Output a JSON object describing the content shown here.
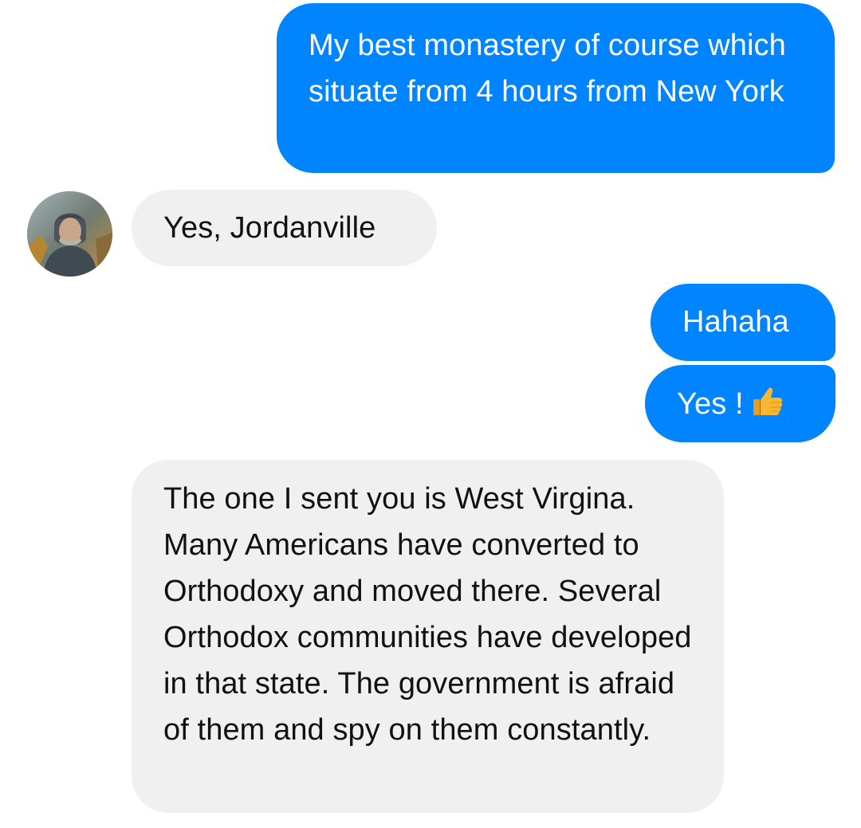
{
  "conversation": {
    "messages": [
      {
        "sender": "me",
        "text": "My best monastery of course which situate from 4 hours from New York"
      },
      {
        "sender": "contact",
        "text": "Yes, Jordanville"
      },
      {
        "sender": "me",
        "text": "Hahaha"
      },
      {
        "sender": "me",
        "text": "Yes !",
        "emoji": "thumbs-up-emoji"
      },
      {
        "sender": "contact",
        "text": "The one I sent you is West Virgina. Many Americans have converted to Orthodoxy and moved there. Several Orthodox communities have developed in that state. The government is afraid of them and spy on them constantly."
      }
    ]
  },
  "colors": {
    "outgoing_bubble": "#0084ff",
    "incoming_bubble": "#f1f0f0",
    "thumbs_up": "#f7b731"
  }
}
